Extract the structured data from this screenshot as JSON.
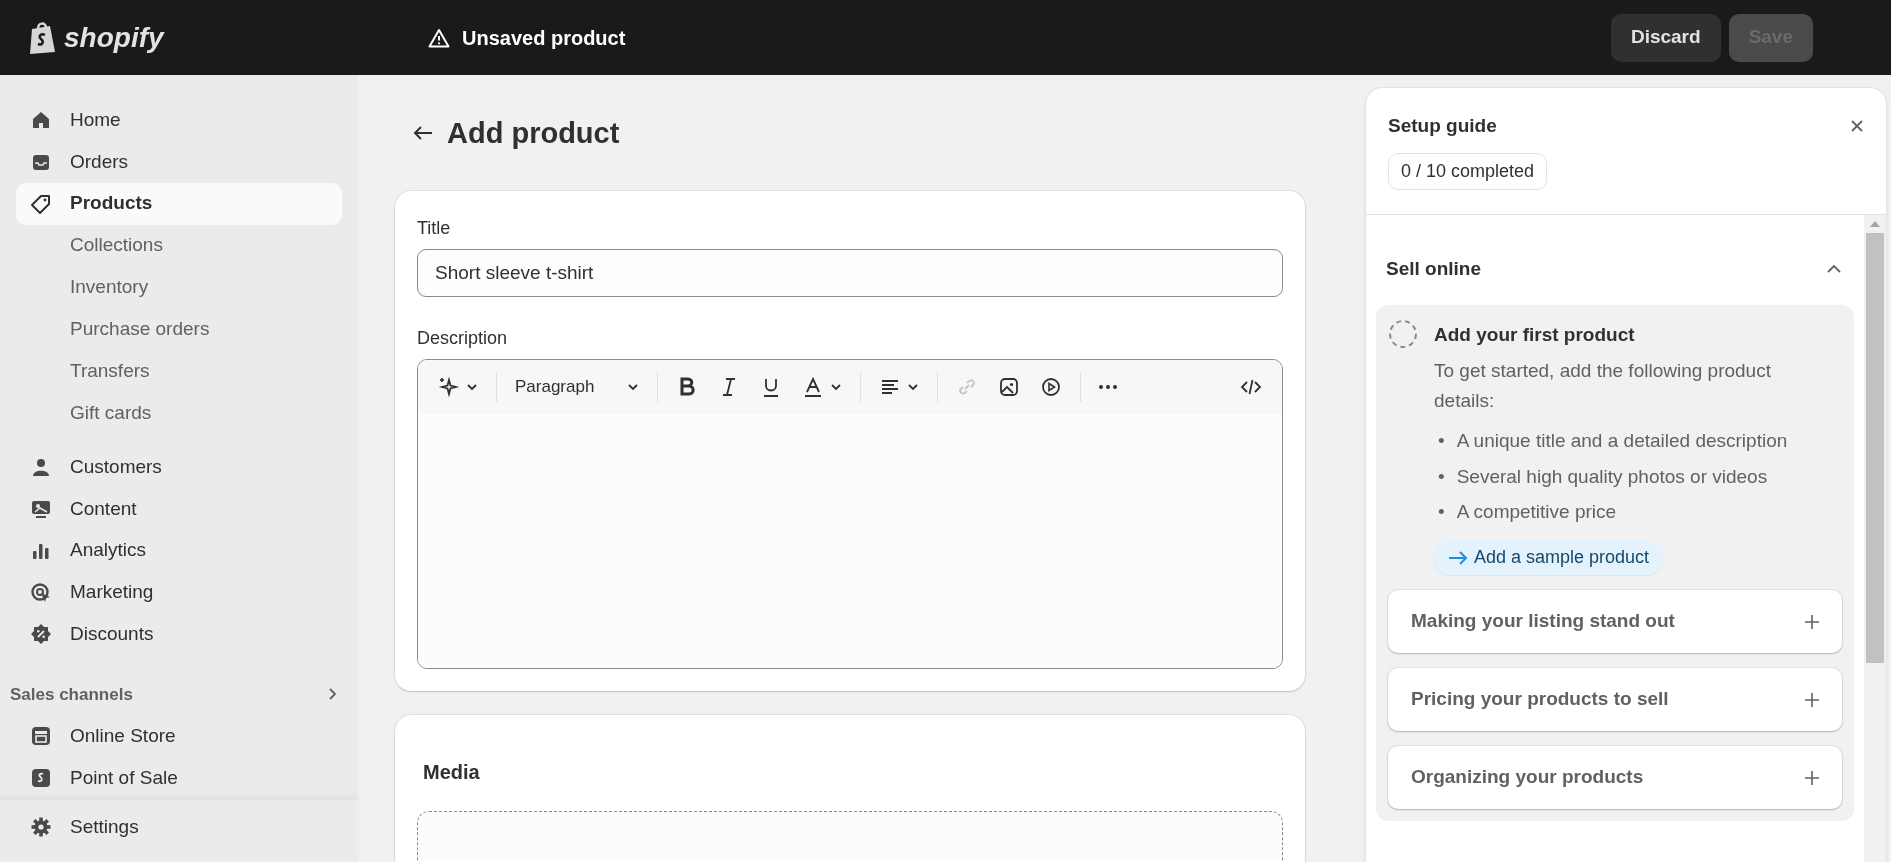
{
  "topbar": {
    "logo": "shopify",
    "title": "Unsaved product",
    "buttons": [
      {
        "label": "Discard",
        "disabled": false
      },
      {
        "label": "Save",
        "disabled": true
      }
    ]
  },
  "sidebar": {
    "items": [
      {
        "label": "Home",
        "selected": false
      },
      {
        "label": "Orders",
        "selected": false
      },
      {
        "label": "Products",
        "selected": true,
        "children": [
          {
            "label": "Collections",
            "selected": false
          },
          {
            "label": "Inventory",
            "selected": false
          },
          {
            "label": "Purchase orders",
            "selected": false
          },
          {
            "label": "Transfers",
            "selected": false
          },
          {
            "label": "Gift cards",
            "selected": false
          }
        ]
      },
      {
        "label": "Customers",
        "selected": false
      },
      {
        "label": "Content",
        "selected": false
      },
      {
        "label": "Analytics",
        "selected": false
      },
      {
        "label": "Marketing",
        "selected": false
      },
      {
        "label": "Discounts",
        "selected": false
      }
    ],
    "section": {
      "label": "Sales channels",
      "items": [
        {
          "label": "Online Store",
          "selected": false
        },
        {
          "label": "Point of Sale",
          "selected": false
        }
      ]
    },
    "footer": {
      "label": "Settings",
      "selected": false
    }
  },
  "page": {
    "title": "Add product",
    "form": {
      "title_label": "Title",
      "title_value": "Short sleeve t-shirt",
      "description_label": "Description",
      "toolbar": [
        {
          "kind": "magic",
          "disabled": false
        },
        {
          "kind": "format",
          "label": "Paragraph",
          "disabled": false
        },
        {
          "kind": "bold",
          "disabled": false
        },
        {
          "kind": "italic",
          "disabled": false
        },
        {
          "kind": "underline",
          "disabled": false
        },
        {
          "kind": "color",
          "disabled": false
        },
        {
          "kind": "align",
          "disabled": false
        },
        {
          "kind": "link",
          "disabled": true
        },
        {
          "kind": "image",
          "disabled": false
        },
        {
          "kind": "video",
          "disabled": false
        },
        {
          "kind": "more",
          "disabled": false
        },
        {
          "kind": "code",
          "disabled": false
        }
      ]
    },
    "media": {
      "title": "Media"
    }
  },
  "setup_guide": {
    "title": "Setup guide",
    "progress": "0 / 10 completed",
    "section": {
      "title": "Sell online",
      "expanded": true,
      "task": {
        "title": "Add your first product",
        "checked": false,
        "description": "To get started, add the following product details:",
        "bullet_marker": "•",
        "bullets": [
          "A unique title and a detailed description",
          "Several high quality photos or videos",
          "A competitive price"
        ],
        "action": "Add a sample product"
      },
      "collapsed_tasks": [
        {
          "title": "Making your listing stand out",
          "expanded": false
        },
        {
          "title": "Pricing your products to sell",
          "expanded": false
        },
        {
          "title": "Organizing your products",
          "expanded": false
        }
      ]
    }
  }
}
